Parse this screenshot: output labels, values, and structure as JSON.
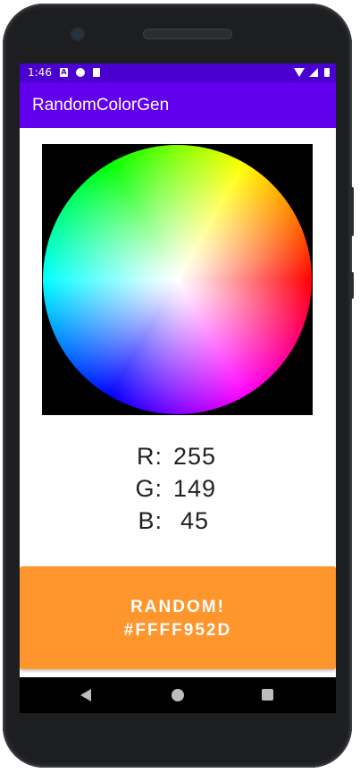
{
  "status_bar": {
    "time": "1:46",
    "icons": [
      "a-notification-icon",
      "p-notification-icon",
      "sd-card-icon",
      "wifi-icon",
      "signal-icon",
      "battery-icon"
    ]
  },
  "app_bar": {
    "title": "RandomColorGen"
  },
  "color": {
    "r_label": "R:",
    "r_value": "255",
    "g_label": "G:",
    "g_value": "149",
    "b_label": "B:",
    "b_value": "45",
    "hex": "#FFFF952D"
  },
  "button": {
    "line1": "RANDOM!",
    "line2": "#FFFF952D"
  },
  "colors": {
    "primary": "#6200ee",
    "status_bar": "#4a00cf",
    "button": "#ff952d"
  },
  "nav": {
    "buttons": [
      "back",
      "home",
      "recents"
    ]
  }
}
